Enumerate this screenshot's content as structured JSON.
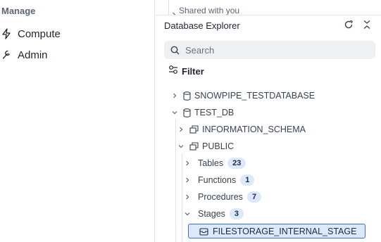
{
  "sidebar": {
    "section_label": "Manage",
    "items": [
      {
        "label": "Compute",
        "icon": "lightning-icon"
      },
      {
        "label": "Admin",
        "icon": "wrench-icon"
      }
    ]
  },
  "explorer": {
    "top_strip_text": "Shared with you",
    "title": "Database Explorer",
    "search": {
      "placeholder": "Search",
      "value": ""
    },
    "filter_label": "Filter",
    "tree": {
      "db1": "SNOWPIPE_TESTDATABASE",
      "db2": "TEST_DB",
      "schema1": "INFORMATION_SCHEMA",
      "schema2": "PUBLIC",
      "tables_label": "Tables",
      "tables_count": "23",
      "functions_label": "Functions",
      "functions_count": "1",
      "procedures_label": "Procedures",
      "procedures_count": "7",
      "stages_label": "Stages",
      "stages_count": "3",
      "stage1": "FILESTORAGE_INTERNAL_STAGE"
    }
  },
  "colors": {
    "accent": "#3b6fd8",
    "selected_bg": "#dce8fc",
    "badge_bg": "#dde8fb"
  }
}
